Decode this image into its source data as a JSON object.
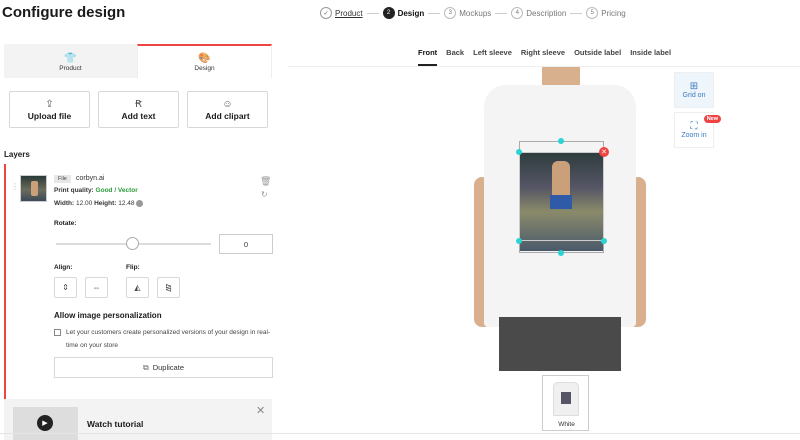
{
  "header": {
    "title": "Configure design"
  },
  "steps": [
    {
      "num": "✓",
      "label": "Product",
      "state": "done"
    },
    {
      "num": "2",
      "label": "Design",
      "state": "active"
    },
    {
      "num": "3",
      "label": "Mockups",
      "state": "todo"
    },
    {
      "num": "4",
      "label": "Description",
      "state": "todo"
    },
    {
      "num": "5",
      "label": "Pricing",
      "state": "todo"
    }
  ],
  "tabs": {
    "product": "Product",
    "design": "Design"
  },
  "add": {
    "upload": "Upload file",
    "text": "Add text",
    "clipart": "Add clipart"
  },
  "layers": {
    "heading": "Layers",
    "file_tag": "File",
    "filename": "corbyn.ai",
    "print_quality_label": "Print quality:",
    "print_quality_value": "Good / Vector",
    "width_label": "Width:",
    "width_value": "12.00",
    "height_label": "Height:",
    "height_value": "12.48",
    "rotate_label": "Rotate:",
    "rotate_value": "0",
    "align_label": "Align:",
    "flip_label": "Flip:",
    "personalization_heading": "Allow image personalization",
    "personalization_text": "Let your customers create personalized versions of your design in real-time on your store",
    "duplicate": "Duplicate"
  },
  "tutorial": {
    "label": "Watch tutorial"
  },
  "view_tabs": [
    "Front",
    "Back",
    "Left sleeve",
    "Right sleeve",
    "Outside label",
    "Inside label"
  ],
  "controls": {
    "grid": "Grid on",
    "zoom": "Zoom in",
    "badge": "New"
  },
  "variant": {
    "label": "White"
  },
  "colors": {
    "accent": "#e44444",
    "good": "#2a9d3a",
    "link": "#3a7ac0"
  }
}
